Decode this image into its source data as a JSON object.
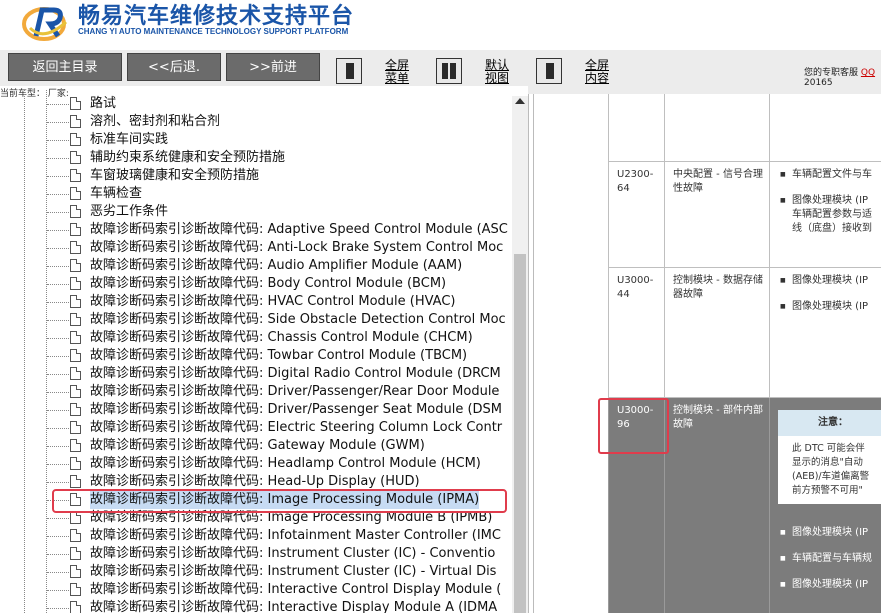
{
  "header": {
    "title": "畅易汽车维修技术支持平台",
    "subtitle": "CHANG YI AUTO MAINTENANCE TECHNOLOGY SUPPORT PLATFORM"
  },
  "toolbar": {
    "home": "返回主目录",
    "back": "<<后退.",
    "forward": ">>前进",
    "view1": [
      "全屏",
      "菜单"
    ],
    "view2": [
      "默认",
      "视图"
    ],
    "view3": [
      "全屏",
      "内容"
    ],
    "support_label": "您的专职客服",
    "support_qq": "QQ",
    "support_num": "20165"
  },
  "tree": {
    "header": "当前车型： 厂家:",
    "items": [
      "路试",
      "溶剂、密封剂和粘合剂",
      "标准车间实践",
      "辅助约束系统健康和安全预防措施",
      "车窗玻璃健康和安全预防措施",
      "车辆检查",
      "恶劣工作条件",
      "故障诊断码索引诊断故障代码: Adaptive Speed Control Module (ASC",
      "故障诊断码索引诊断故障代码: Anti-Lock Brake System Control Moc",
      "故障诊断码索引诊断故障代码: Audio Amplifier Module (AAM)",
      "故障诊断码索引诊断故障代码: Body Control Module (BCM)",
      "故障诊断码索引诊断故障代码: HVAC Control Module (HVAC)",
      "故障诊断码索引诊断故障代码: Side Obstacle Detection Control Moc",
      "故障诊断码索引诊断故障代码: Chassis Control Module (CHCM)",
      "故障诊断码索引诊断故障代码: Towbar Control Module (TBCM)",
      "故障诊断码索引诊断故障代码: Digital Radio Control Module (DRCM",
      "故障诊断码索引诊断故障代码: Driver/Passenger/Rear Door Module",
      "故障诊断码索引诊断故障代码: Driver/Passenger Seat Module (DSM",
      "故障诊断码索引诊断故障代码: Electric Steering Column Lock Contr",
      "故障诊断码索引诊断故障代码: Gateway Module (GWM)",
      "故障诊断码索引诊断故障代码: Headlamp Control Module (HCM)",
      "故障诊断码索引诊断故障代码: Head-Up Display (HUD)",
      "故障诊断码索引诊断故障代码: Image Processing Module (IPMA)",
      "故障诊断码索引诊断故障代码: Image Processing Module B (IPMB)",
      "故障诊断码索引诊断故障代码: Infotainment Master Controller (IMC",
      "故障诊断码索引诊断故障代码: Instrument Cluster (IC) - Conventio",
      "故障诊断码索引诊断故障代码: Instrument Cluster (IC) - Virtual Dis",
      "故障诊断码索引诊断故障代码: Interactive Control Display Module (",
      "故障诊断码索引诊断故障代码: Interactive Display Module A (IDMA"
    ]
  },
  "dtc": {
    "rows": [
      {
        "code": "",
        "desc": "",
        "items": []
      },
      {
        "code": "U2300-64",
        "desc": "中央配置 - 信号合理性故障",
        "items": [
          "车辆配置文件与车",
          "图像处理模块 (IP",
          "车辆配置参数与适",
          "线（底盘）接收到"
        ]
      },
      {
        "code": "U3000-44",
        "desc": "控制模块 - 数据存储器故障",
        "items": [
          "图像处理模块 (IP",
          "图像处理模块 (IP"
        ]
      },
      {
        "code": "U3000-96",
        "desc": "控制模块 - 部件内部故障",
        "items": [
          "图像处理模块 (IP",
          "车辆配置与车辆规",
          "图像处理模块 (IP"
        ]
      }
    ],
    "note_title": "注意：",
    "note_lines": [
      "此 DTC 可能会伴",
      "显示的消息\"自动",
      "(AEB)/车道偏离警",
      "前方预警不可用\""
    ]
  }
}
